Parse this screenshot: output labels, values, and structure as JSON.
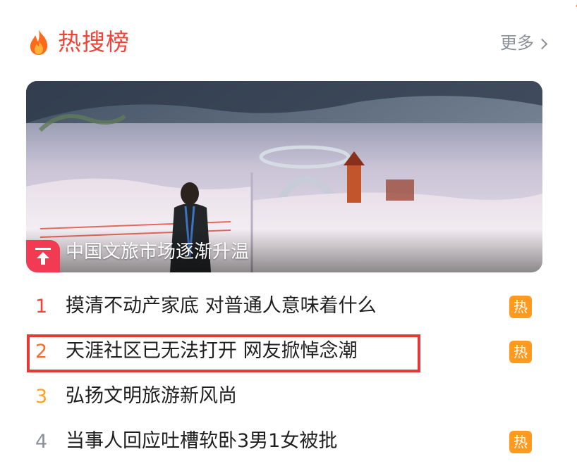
{
  "header": {
    "title": "热搜榜",
    "more_label": "更多",
    "icons": {
      "flame": "flame-icon",
      "chevron": "chevron-right-icon"
    }
  },
  "banner": {
    "caption": "中国文旅市场逐渐升温",
    "badge_icon": "arrow-up-pin-icon"
  },
  "items": [
    {
      "rank": "1",
      "text": "摸清不动产家底 对普通人意味着什么",
      "hot": "热",
      "rank_color": "#f04438"
    },
    {
      "rank": "2",
      "text": "天涯社区已无法打开 网友掀悼念潮",
      "hot": "热",
      "rank_color": "#ff6a2b"
    },
    {
      "rank": "3",
      "text": "弘扬文明旅游新风尚",
      "hot": "",
      "rank_color": "#ffa31a"
    },
    {
      "rank": "4",
      "text": "当事人回应吐槽软卧3男1女被批",
      "hot": "热",
      "rank_color": "#8a8f99"
    }
  ],
  "colors": {
    "accent": "#f04438",
    "hot_badge": "#ff9a1f",
    "highlight": "#e53935",
    "muted": "#8a8f99"
  }
}
